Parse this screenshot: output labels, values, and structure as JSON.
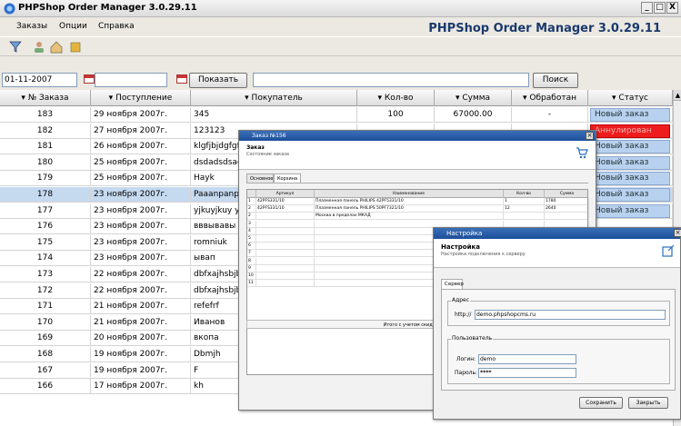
{
  "window": {
    "title": "PHPShop Order Manager 3.0.29.11",
    "min": "_",
    "max": "□",
    "close": "X"
  },
  "menu": [
    "Заказы",
    "Опции",
    "Справка"
  ],
  "brand": "PHPShop Order Manager 3.0.29.11",
  "toolbar_icons": [
    "funnel-icon",
    "user-icon",
    "home-icon",
    "box-icon"
  ],
  "filter": {
    "date_from": "01-11-2007",
    "date_to": "",
    "show_label": "Показать",
    "search_value": "",
    "search_label": "Поиск"
  },
  "columns": [
    "№ Заказа",
    "Поступление",
    "Покупатель",
    "Кол-во",
    "Сумма",
    "Обработан",
    "Статус"
  ],
  "rows": [
    {
      "num": "183",
      "date": "29 ноября 2007г.",
      "buyer": "345",
      "qty": "100",
      "sum": "67000.00",
      "proc": "-",
      "status": "Новый заказ",
      "status_color": "#b8d1ef"
    },
    {
      "num": "182",
      "date": "27 ноября 2007г.",
      "buyer": "123123",
      "qty": "",
      "sum": "",
      "proc": "",
      "status": "Аннулирован",
      "status_color": "#ee1c1c"
    },
    {
      "num": "181",
      "date": "26 ноября 2007г.",
      "buyer": "klgfjbjdgfgfh",
      "qty": "",
      "sum": "",
      "proc": "",
      "status": "Новый заказ",
      "status_color": "#b8d1ef"
    },
    {
      "num": "180",
      "date": "25 ноября 2007г.",
      "buyer": "dsdadsdsad sd d",
      "qty": "",
      "sum": "",
      "proc": "",
      "status": "Новый заказ",
      "status_color": "#b8d1ef"
    },
    {
      "num": "179",
      "date": "25 ноября 2007г.",
      "buyer": "Hayk",
      "qty": "",
      "sum": "",
      "proc": "",
      "status": "Новый заказ",
      "status_color": "#b8d1ef"
    },
    {
      "num": "178",
      "date": "23 ноября 2007г.",
      "buyer": "Paaanpanp pnan",
      "qty": "",
      "sum": "",
      "proc": "",
      "status": "Новый заказ",
      "status_color": "#b8d1ef"
    },
    {
      "num": "177",
      "date": "23 ноября 2007г.",
      "buyer": "yjkuyjkuy yujuy",
      "qty": "",
      "sum": "",
      "proc": "",
      "status": "Новый заказ",
      "status_color": "#b8d1ef"
    },
    {
      "num": "176",
      "date": "23 ноября 2007г.",
      "buyer": "вввывавы ывы",
      "qty": "",
      "sum": "",
      "proc": "",
      "status": "",
      "status_color": ""
    },
    {
      "num": "175",
      "date": "23 ноября 2007г.",
      "buyer": "romniuk",
      "qty": "",
      "sum": "",
      "proc": "",
      "status": "",
      "status_color": ""
    },
    {
      "num": "174",
      "date": "23 ноября 2007г.",
      "buyer": "ывап",
      "qty": "",
      "sum": "",
      "proc": "",
      "status": "",
      "status_color": ""
    },
    {
      "num": "173",
      "date": "22 ноября 2007г.",
      "buyer": "dbfxajhsbjb",
      "qty": "",
      "sum": "",
      "proc": "",
      "status": "",
      "status_color": ""
    },
    {
      "num": "172",
      "date": "22 ноября 2007г.",
      "buyer": "dbfxajhsbjb",
      "qty": "",
      "sum": "",
      "proc": "",
      "status": "",
      "status_color": ""
    },
    {
      "num": "171",
      "date": "21 ноября 2007г.",
      "buyer": "refefrf",
      "qty": "",
      "sum": "",
      "proc": "",
      "status": "",
      "status_color": ""
    },
    {
      "num": "170",
      "date": "21 ноября 2007г.",
      "buyer": "Иванов",
      "qty": "",
      "sum": "",
      "proc": "",
      "status": "",
      "status_color": ""
    },
    {
      "num": "169",
      "date": "20 ноября 2007г.",
      "buyer": "вкопа",
      "qty": "",
      "sum": "",
      "proc": "",
      "status": "",
      "status_color": ""
    },
    {
      "num": "168",
      "date": "19 ноября 2007г.",
      "buyer": "Dbmjh",
      "qty": "",
      "sum": "",
      "proc": "",
      "status": "",
      "status_color": ""
    },
    {
      "num": "167",
      "date": "19 ноября 2007г.",
      "buyer": "F",
      "qty": "",
      "sum": "",
      "proc": "",
      "status": "",
      "status_color": ""
    },
    {
      "num": "166",
      "date": "17 ноября 2007г.",
      "buyer": "kh",
      "qty": "",
      "sum": "",
      "proc": "",
      "status": "",
      "status_color": ""
    }
  ],
  "order_dialog": {
    "title": "Заказ №156",
    "heading": "Заказ",
    "subheading": "Состояние заказа",
    "tabs": [
      "Основное",
      "Корзина"
    ],
    "cols": [
      "Артикул",
      "Наименование",
      "Кол-во",
      "Сумма"
    ],
    "items": [
      {
        "n": "1",
        "art": "42PFS331/10",
        "name": "Плазменная панель PHILIPS 42PF5331/10",
        "qty": "1",
        "sum": "1780"
      },
      {
        "n": "2",
        "art": "42PFS331/10",
        "name": "Плазменная панель PHILIPS 50PF7321/10",
        "qty": "12",
        "sum": "2640"
      },
      {
        "n": "2",
        "art": "",
        "name": "Москва в пределах МКАД",
        "qty": "",
        "sum": ""
      },
      {
        "n": "3",
        "art": "",
        "name": "",
        "qty": "",
        "sum": ""
      },
      {
        "n": "4",
        "art": "",
        "name": "",
        "qty": "",
        "sum": ""
      },
      {
        "n": "5",
        "art": "",
        "name": "",
        "qty": "",
        "sum": ""
      },
      {
        "n": "6",
        "art": "",
        "name": "",
        "qty": "",
        "sum": ""
      },
      {
        "n": "7",
        "art": "",
        "name": "",
        "qty": "",
        "sum": ""
      },
      {
        "n": "8",
        "art": "",
        "name": "",
        "qty": "",
        "sum": ""
      },
      {
        "n": "9",
        "art": "",
        "name": "",
        "qty": "",
        "sum": ""
      },
      {
        "n": "10",
        "art": "",
        "name": "",
        "qty": "",
        "sum": ""
      },
      {
        "n": "11",
        "art": "",
        "name": "",
        "qty": "",
        "sum": ""
      }
    ],
    "total": "Итого с учетом скидки: 10%"
  },
  "settings_dialog": {
    "title": "Настройка",
    "heading": "Настройка",
    "subheading": "Настройка подключения к серверу",
    "tab": "Сервер",
    "group_address": "Адрес",
    "url_prefix": "http://",
    "url": "demo.phpshopcms.ru",
    "group_user": "Пользователь",
    "login_label": "Логин:",
    "login": "demo",
    "password_label": "Пароль:",
    "password": "****",
    "save": "Сохранить",
    "close": "Закрыть"
  }
}
